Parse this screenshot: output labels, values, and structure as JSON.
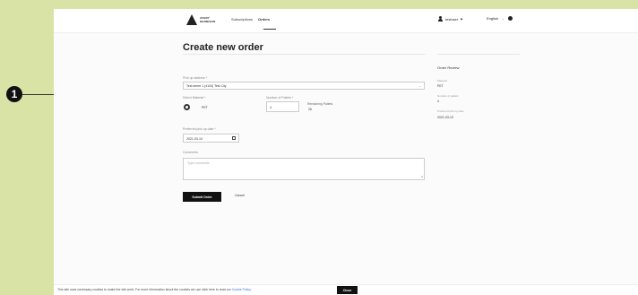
{
  "callout": {
    "number": "1"
  },
  "header": {
    "logo_line1": "AVERY",
    "logo_line2": "DENNISON",
    "nav": [
      {
        "label": "Subscriptions"
      },
      {
        "label": "Orders"
      }
    ],
    "user_name": "testuser",
    "language": "English"
  },
  "form": {
    "title": "Create new order",
    "pickup_label": "Pick up address *",
    "pickup_value": "Test street 1 (4104) Test City",
    "material_label": "Select Material *",
    "material_name": "PET",
    "pallets_label": "Number of Pallets *",
    "pallets_value": "4",
    "remaining_label": "Remaining Pallets",
    "remaining_value": "26",
    "date_label": "Preferred pick up date *",
    "date_value": "2021-03-10",
    "comments_label": "Comments",
    "comments_placeholder": "Type comments",
    "submit_label": "Submit Order",
    "cancel_label": "Cancel"
  },
  "review": {
    "title": "Order Review",
    "material_label": "Material",
    "material_value": "PET",
    "pallets_label": "Number of pallets",
    "pallets_value": "4",
    "date_label": "Preferred pick up date",
    "date_value": "2021-03-10"
  },
  "cookie": {
    "text": "This site uses necessary cookies to make the site work. For more information about the cookies we use click here to read our",
    "link_text": "Cookie Policy.",
    "close_label": "Close"
  },
  "colors": {
    "page_background": "#d9e3a6",
    "primary_button": "#111111",
    "link": "#3a6fd8"
  }
}
